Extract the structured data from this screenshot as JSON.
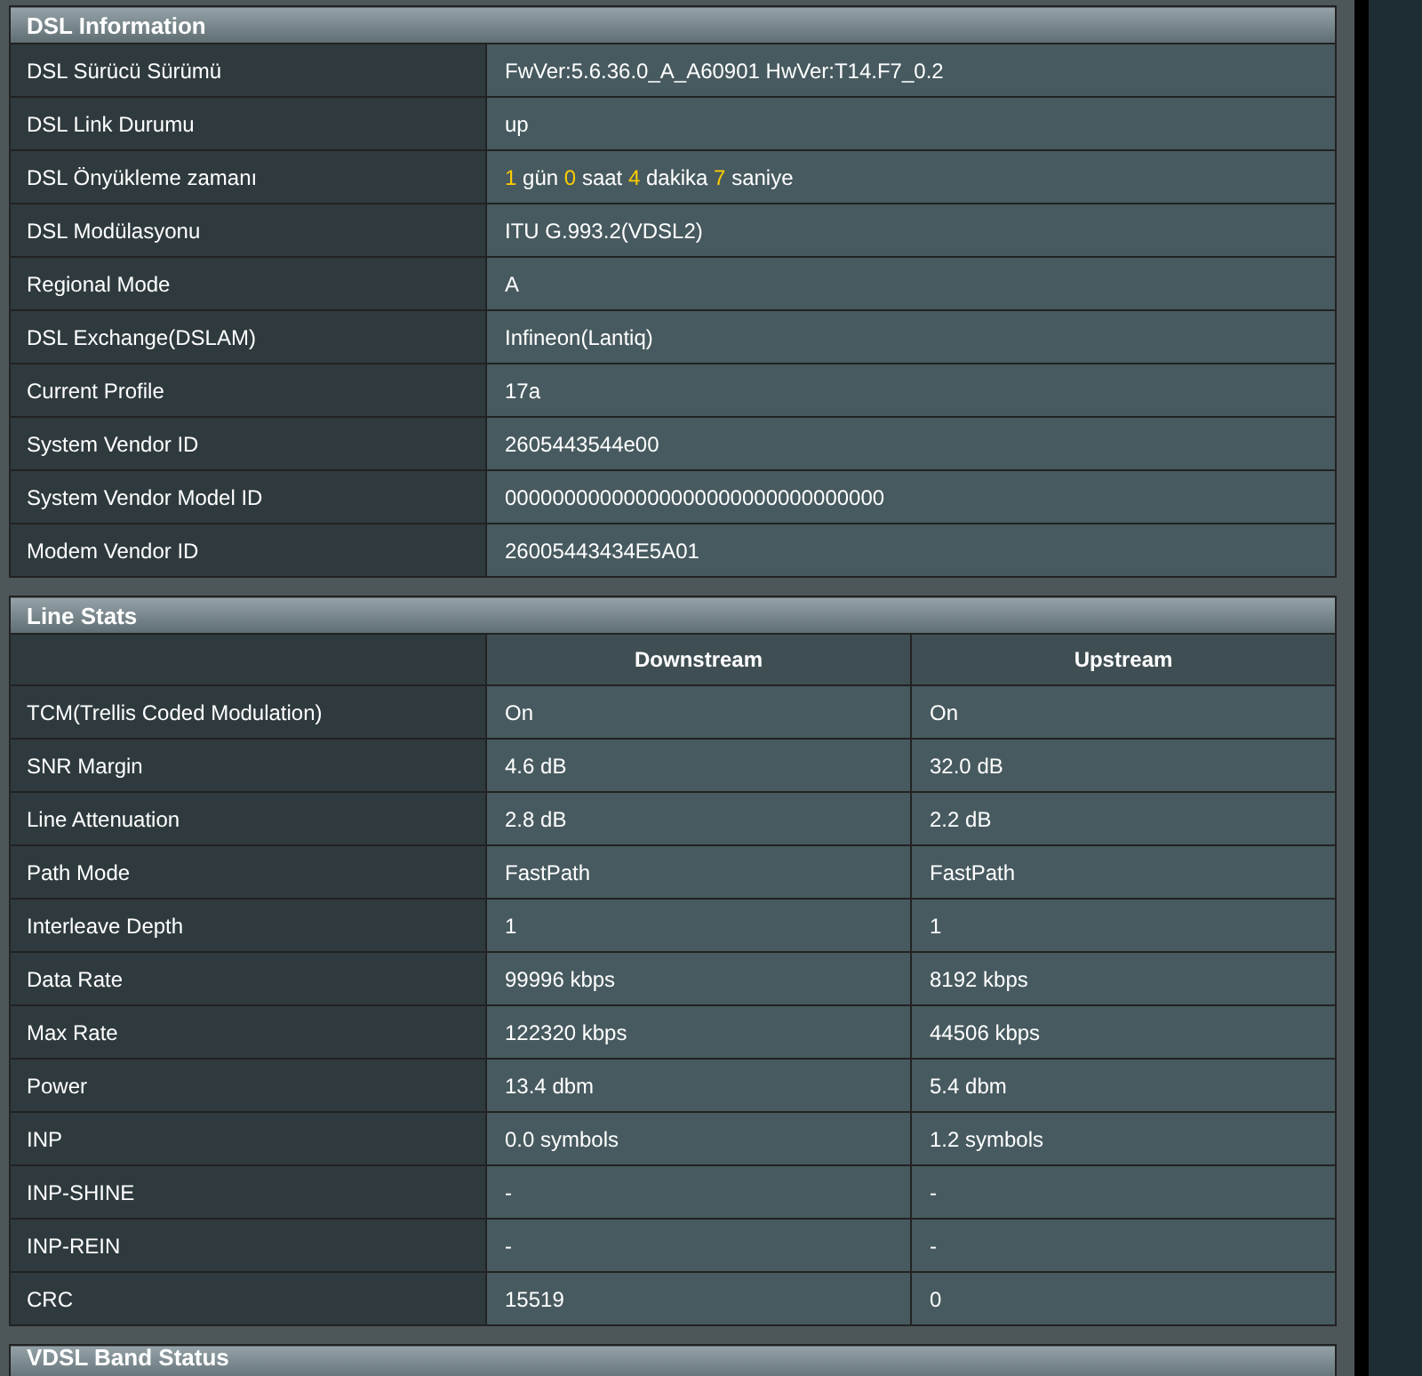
{
  "dsl_information": {
    "title": "DSL Information",
    "rows": [
      {
        "label": "DSL Sürücü Sürümü",
        "value": "FwVer:5.6.36.0_A_A60901 HwVer:T14.F7_0.2"
      },
      {
        "label": "DSL Link Durumu",
        "value": "up"
      },
      {
        "label": "DSL Önyükleme zamanı",
        "value_parts": [
          {
            "text": "1",
            "kind": "number"
          },
          {
            "text": "gün",
            "kind": "unit"
          },
          {
            "text": "0",
            "kind": "number"
          },
          {
            "text": "saat",
            "kind": "unit"
          },
          {
            "text": "4",
            "kind": "number"
          },
          {
            "text": "dakika",
            "kind": "unit"
          },
          {
            "text": "7",
            "kind": "number"
          },
          {
            "text": "saniye",
            "kind": "unit"
          }
        ]
      },
      {
        "label": "DSL Modülasyonu",
        "value": "ITU G.993.2(VDSL2)"
      },
      {
        "label": "Regional Mode",
        "value": "A"
      },
      {
        "label": "DSL Exchange(DSLAM)",
        "value": "Infineon(Lantiq)"
      },
      {
        "label": "Current Profile",
        "value": "17a"
      },
      {
        "label": "System Vendor ID",
        "value": "2605443544e00"
      },
      {
        "label": "System Vendor Model ID",
        "value": "00000000000000000000000000000000"
      },
      {
        "label": "Modem Vendor ID",
        "value": "26005443434E5A01"
      }
    ]
  },
  "line_stats": {
    "title": "Line Stats",
    "columns": [
      "Downstream",
      "Upstream"
    ],
    "rows": [
      {
        "label": "TCM(Trellis Coded Modulation)",
        "downstream": "On",
        "upstream": "On"
      },
      {
        "label": "SNR Margin",
        "downstream": "4.6 dB",
        "upstream": "32.0 dB"
      },
      {
        "label": "Line Attenuation",
        "downstream": "2.8 dB",
        "upstream": "2.2 dB"
      },
      {
        "label": "Path Mode",
        "downstream": "FastPath",
        "upstream": "FastPath"
      },
      {
        "label": "Interleave Depth",
        "downstream": "1",
        "upstream": "1"
      },
      {
        "label": "Data Rate",
        "downstream": "99996 kbps",
        "upstream": "8192 kbps"
      },
      {
        "label": "Max Rate",
        "downstream": "122320 kbps",
        "upstream": "44506 kbps"
      },
      {
        "label": "Power",
        "downstream": "13.4 dbm",
        "upstream": "5.4 dbm"
      },
      {
        "label": "INP",
        "downstream": "0.0 symbols",
        "upstream": "1.2 symbols"
      },
      {
        "label": "INP-SHINE",
        "downstream": "-",
        "upstream": "-"
      },
      {
        "label": "INP-REIN",
        "downstream": "-",
        "upstream": "-"
      },
      {
        "label": "CRC",
        "downstream": "15519",
        "upstream": "0"
      }
    ]
  },
  "vdsl_band_status": {
    "title": "VDSL Band Status"
  }
}
